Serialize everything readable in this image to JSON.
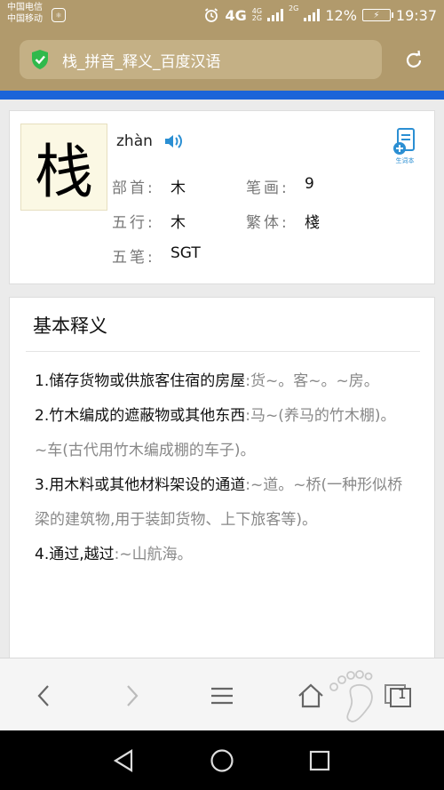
{
  "status_bar": {
    "carrier_1": "中国电信",
    "carrier_2": "中国移动",
    "network_4g": "4G",
    "network_4g_top": "4G",
    "network_4g_bottom": "2G",
    "network_2g": "2G",
    "battery_percent": "12%",
    "time": "19:37",
    "carrier_icon": "carrier-badge-icon"
  },
  "browser": {
    "page_title": "栈_拼音_释义_百度汉语",
    "secure_icon": "shield-check-icon",
    "refresh_icon": "refresh-icon",
    "accent_color": "#1c64d8",
    "chrome_color": "#b19a6c"
  },
  "entry": {
    "character": "栈",
    "pinyin": "zhàn",
    "vocab_label": "生词本",
    "radical_label": "部首:",
    "radical_value": "木",
    "strokes_label": "笔画:",
    "strokes_value": "9",
    "wuxing_label": "五行:",
    "wuxing_value": "木",
    "traditional_label": "繁体:",
    "traditional_value": "棧",
    "wubi_label": "五笔:",
    "wubi_value": "SGT"
  },
  "definitions": {
    "title": "基本释义",
    "items": [
      {
        "main": "1.储存货物或供旅客住宿的房屋",
        "ex": ":货~。客~。~房。"
      },
      {
        "main": "2.竹木编成的遮蔽物或其他东西",
        "ex": ":马~(养马的竹木棚)。~车(古代用竹木编成棚的车子)。"
      },
      {
        "main": "3.用木料或其他材料架设的通道",
        "ex": ":~道。~桥(一种形似桥梁的建筑物,用于装卸货物、上下旅客等)。"
      },
      {
        "main": "4.通过,越过",
        "ex": ":~山航海。"
      }
    ]
  },
  "toolbar": {
    "back": "chevron-left-icon",
    "forward": "chevron-right-icon",
    "menu": "menu-icon",
    "home": "home-icon",
    "tabs": "tabs-icon",
    "tabs_count": "1"
  },
  "navbar": {
    "back": "nav-back-icon",
    "home": "nav-home-icon",
    "recents": "nav-recents-icon"
  }
}
